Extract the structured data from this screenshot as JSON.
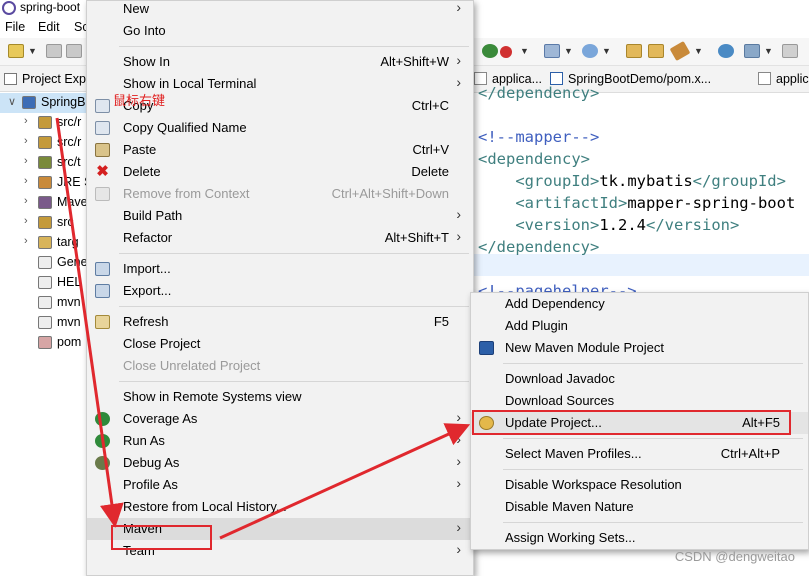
{
  "window": {
    "title": "spring-boot"
  },
  "menubar": {
    "file": "File",
    "edit": "Edit",
    "cut_item": "Sc"
  },
  "explorer": {
    "title": "Project Exp",
    "items": [
      {
        "arrow": "∨",
        "label": "SpringB"
      },
      {
        "arrow": "›",
        "label": "src/r"
      },
      {
        "arrow": "›",
        "label": "src/r"
      },
      {
        "arrow": "›",
        "label": "src/t"
      },
      {
        "arrow": "›",
        "label": "JRE S"
      },
      {
        "arrow": "›",
        "label": "Mave"
      },
      {
        "arrow": "›",
        "label": "src"
      },
      {
        "arrow": "›",
        "label": "targ"
      },
      {
        "arrow": "",
        "label": "Gene"
      },
      {
        "arrow": "",
        "label": "HEL"
      },
      {
        "arrow": "",
        "label": "mvn"
      },
      {
        "arrow": "",
        "label": "mvn"
      },
      {
        "arrow": "",
        "label": "pom"
      }
    ]
  },
  "editor_tabs": [
    {
      "label": "applica..."
    },
    {
      "label": "SpringBootDemo/pom.x..."
    },
    {
      "label": "applic"
    }
  ],
  "code_lines": [
    {
      "parts": [
        [
          "tag",
          "</dependency>"
        ]
      ]
    },
    {
      "parts": [
        [
          "txt",
          ""
        ]
      ]
    },
    {
      "parts": [
        [
          "cmt",
          "<!--mapper-->"
        ]
      ]
    },
    {
      "parts": [
        [
          "tag",
          "<dependency>"
        ]
      ]
    },
    {
      "parts": [
        [
          "tag",
          "    <groupId>"
        ],
        [
          "txt",
          "tk.mybatis"
        ],
        [
          "tag",
          "</groupId>"
        ]
      ]
    },
    {
      "parts": [
        [
          "tag",
          "    <artifactId>"
        ],
        [
          "txt",
          "mapper-spring-boot"
        ]
      ]
    },
    {
      "parts": [
        [
          "tag",
          "    <version>"
        ],
        [
          "txt",
          "1.2.4"
        ],
        [
          "tag",
          "</version>"
        ]
      ]
    },
    {
      "parts": [
        [
          "tag",
          "</dependency>"
        ]
      ]
    },
    {
      "parts": [
        [
          "txt",
          ""
        ]
      ]
    },
    {
      "parts": [
        [
          "cmt",
          "<!--pagehelper-->"
        ]
      ]
    }
  ],
  "context_menu": {
    "items": [
      {
        "label": "New",
        "submenu": true,
        "icon": ""
      },
      {
        "label": "Go Into",
        "icon": ""
      },
      {
        "sep": true
      },
      {
        "label": "Show In",
        "shortcut": "Alt+Shift+W",
        "submenu": true,
        "icon": ""
      },
      {
        "label": "Show in Local Terminal",
        "submenu": true,
        "icon": ""
      },
      {
        "label": "Copy",
        "shortcut": "Ctrl+C",
        "icon": "copy-icon"
      },
      {
        "label": "Copy Qualified Name",
        "icon": "copy-qualified-icon"
      },
      {
        "label": "Paste",
        "shortcut": "Ctrl+V",
        "icon": "paste-icon"
      },
      {
        "label": "Delete",
        "shortcut": "Delete",
        "icon": "delete-icon"
      },
      {
        "label": "Remove from Context",
        "shortcut": "Ctrl+Alt+Shift+Down",
        "disabled": true,
        "icon": "remove-context-icon"
      },
      {
        "label": "Build Path",
        "submenu": true,
        "icon": ""
      },
      {
        "label": "Refactor",
        "shortcut": "Alt+Shift+T",
        "submenu": true,
        "icon": ""
      },
      {
        "sep": true
      },
      {
        "label": "Import...",
        "icon": "import-icon"
      },
      {
        "label": "Export...",
        "icon": "export-icon"
      },
      {
        "sep": true
      },
      {
        "label": "Refresh",
        "shortcut": "F5",
        "icon": "refresh-icon"
      },
      {
        "label": "Close Project",
        "icon": ""
      },
      {
        "label": "Close Unrelated Project",
        "disabled": true,
        "icon": ""
      },
      {
        "sep": true
      },
      {
        "label": "Show in Remote Systems view",
        "icon": ""
      },
      {
        "label": "Coverage As",
        "submenu": true,
        "icon": "coverage-icon"
      },
      {
        "label": "Run As",
        "submenu": true,
        "icon": "run-icon"
      },
      {
        "label": "Debug As",
        "submenu": true,
        "icon": "debug-icon"
      },
      {
        "label": "Profile As",
        "submenu": true,
        "icon": ""
      },
      {
        "label": "Restore from Local History...",
        "icon": ""
      },
      {
        "label": "Maven",
        "submenu": true,
        "icon": "",
        "highlight": true
      },
      {
        "label": "Team",
        "submenu": true,
        "icon": ""
      }
    ]
  },
  "maven_submenu": {
    "items": [
      {
        "label": "Add Dependency",
        "icon": ""
      },
      {
        "label": "Add Plugin",
        "icon": ""
      },
      {
        "label": "New Maven Module Project",
        "icon": "maven-module-icon"
      },
      {
        "sep": true
      },
      {
        "label": "Download Javadoc",
        "icon": ""
      },
      {
        "label": "Download Sources",
        "icon": ""
      },
      {
        "label": "Update Project...",
        "shortcut": "Alt+F5",
        "icon": "update-project-icon",
        "highlight": true
      },
      {
        "sep": true
      },
      {
        "label": "Select Maven Profiles...",
        "shortcut": "Ctrl+Alt+P",
        "icon": ""
      },
      {
        "sep": true
      },
      {
        "label": "Disable Workspace Resolution",
        "icon": ""
      },
      {
        "label": "Disable Maven Nature",
        "icon": ""
      },
      {
        "sep": true
      },
      {
        "label": "Assign Working Sets...",
        "icon": ""
      }
    ]
  },
  "annotation": {
    "label": "鼠标右键"
  },
  "watermark": "CSDN @dengweitao",
  "colors": {
    "annotation_red": "#e0282e",
    "selection": "#cce4f7",
    "menu_bg": "#f2f2f2"
  }
}
